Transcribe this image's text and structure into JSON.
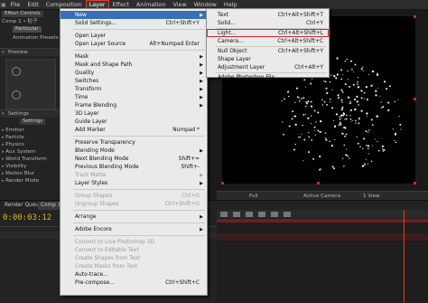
{
  "menubar": {
    "items": [
      "File",
      "Edit",
      "Composition",
      "Layer",
      "Effect",
      "Animation",
      "View",
      "Window",
      "Help"
    ],
    "active_index": 3
  },
  "left_panel": {
    "comp_label": "Comp 1 • 粒子",
    "particular_badge": "Particular",
    "effect_controls_tab": "Effect Controls",
    "preset_label": "Animation Presets",
    "preview_label": "Preview",
    "settings_label": "Settings",
    "settings_button": "Settings",
    "params": [
      "Emitter",
      "Particle",
      "Physics",
      "Aux System",
      "World Transform",
      "Visibility",
      "Motion Blur",
      "Render Mode"
    ]
  },
  "layer_menu": {
    "items": [
      {
        "label": "New",
        "shortcut": "",
        "submenu": true,
        "state": "highlighted"
      },
      {
        "label": "Solid Settings...",
        "shortcut": "Ctrl+Shift+Y",
        "submenu": false,
        "state": "enabled"
      },
      {
        "sep": true
      },
      {
        "label": "Open Layer",
        "shortcut": "",
        "submenu": false,
        "state": "enabled"
      },
      {
        "label": "Open Layer Source",
        "shortcut": "Alt+Numpad Enter",
        "submenu": false,
        "state": "enabled"
      },
      {
        "sep": true
      },
      {
        "label": "Mask",
        "shortcut": "",
        "submenu": true,
        "state": "enabled"
      },
      {
        "label": "Mask and Shape Path",
        "shortcut": "",
        "submenu": true,
        "state": "enabled"
      },
      {
        "label": "Quality",
        "shortcut": "",
        "submenu": true,
        "state": "enabled"
      },
      {
        "label": "Switches",
        "shortcut": "",
        "submenu": true,
        "state": "enabled"
      },
      {
        "label": "Transform",
        "shortcut": "",
        "submenu": true,
        "state": "enabled"
      },
      {
        "label": "Time",
        "shortcut": "",
        "submenu": true,
        "state": "enabled"
      },
      {
        "label": "Frame Blending",
        "shortcut": "",
        "submenu": true,
        "state": "enabled"
      },
      {
        "label": "3D Layer",
        "shortcut": "",
        "submenu": false,
        "state": "enabled"
      },
      {
        "label": "Guide Layer",
        "shortcut": "",
        "submenu": false,
        "state": "enabled"
      },
      {
        "label": "Add Marker",
        "shortcut": "Numpad *",
        "submenu": false,
        "state": "enabled"
      },
      {
        "sep": true
      },
      {
        "label": "Preserve Transparency",
        "shortcut": "",
        "submenu": false,
        "state": "enabled"
      },
      {
        "label": "Blending Mode",
        "shortcut": "",
        "submenu": true,
        "state": "enabled"
      },
      {
        "label": "Next Blending Mode",
        "shortcut": "Shift+=",
        "submenu": false,
        "state": "enabled"
      },
      {
        "label": "Previous Blending Mode",
        "shortcut": "Shift+-",
        "submenu": false,
        "state": "enabled"
      },
      {
        "label": "Track Matte",
        "shortcut": "",
        "submenu": true,
        "state": "disabled"
      },
      {
        "label": "Layer Styles",
        "shortcut": "",
        "submenu": true,
        "state": "enabled"
      },
      {
        "sep": true
      },
      {
        "label": "Group Shapes",
        "shortcut": "Ctrl+G",
        "submenu": false,
        "state": "disabled"
      },
      {
        "label": "Ungroup Shapes",
        "shortcut": "Ctrl+Shift+G",
        "submenu": false,
        "state": "disabled"
      },
      {
        "sep": true
      },
      {
        "label": "Arrange",
        "shortcut": "",
        "submenu": true,
        "state": "enabled"
      },
      {
        "sep": true
      },
      {
        "label": "Adobe Encore",
        "shortcut": "",
        "submenu": true,
        "state": "enabled"
      },
      {
        "sep": true
      },
      {
        "label": "Convert to Live Photoshop 3D",
        "shortcut": "",
        "submenu": false,
        "state": "disabled"
      },
      {
        "label": "Convert to Editable Text",
        "shortcut": "",
        "submenu": false,
        "state": "disabled"
      },
      {
        "label": "Create Shapes from Text",
        "shortcut": "",
        "submenu": false,
        "state": "disabled"
      },
      {
        "label": "Create Masks from Text",
        "shortcut": "",
        "submenu": false,
        "state": "disabled"
      },
      {
        "label": "Auto-trace...",
        "shortcut": "",
        "submenu": false,
        "state": "enabled"
      },
      {
        "label": "Pre-compose...",
        "shortcut": "Ctrl+Shift+C",
        "submenu": false,
        "state": "enabled"
      }
    ]
  },
  "new_submenu": {
    "items": [
      {
        "label": "Text",
        "shortcut": "Ctrl+Alt+Shift+T"
      },
      {
        "label": "Solid...",
        "shortcut": "Ctrl+Y"
      },
      {
        "label": "Light...",
        "shortcut": "Ctrl+Alt+Shift+L",
        "boxed": true
      },
      {
        "label": "Camera...",
        "shortcut": "Ctrl+Alt+Shift+C"
      },
      {
        "label": "Null Object",
        "shortcut": "Ctrl+Alt+Shift+Y"
      },
      {
        "label": "Shape Layer",
        "shortcut": ""
      },
      {
        "label": "Adjustment Layer",
        "shortcut": "Ctrl+Alt+Y"
      },
      {
        "label": "Adobe Photoshop File...",
        "shortcut": ""
      }
    ]
  },
  "viewer_bar": {
    "quality": "Full",
    "camera": "Active Camera",
    "views": "1 View"
  },
  "timeline": {
    "tabs": [
      "Render Queue",
      "Comp 1"
    ],
    "timecode": "0:00:03:12"
  },
  "colors": {
    "highlight": "#3a6fb5",
    "callout_red": "#d9262f",
    "timecode": "#d7b82a",
    "menu_bg": "#eaeaea"
  }
}
